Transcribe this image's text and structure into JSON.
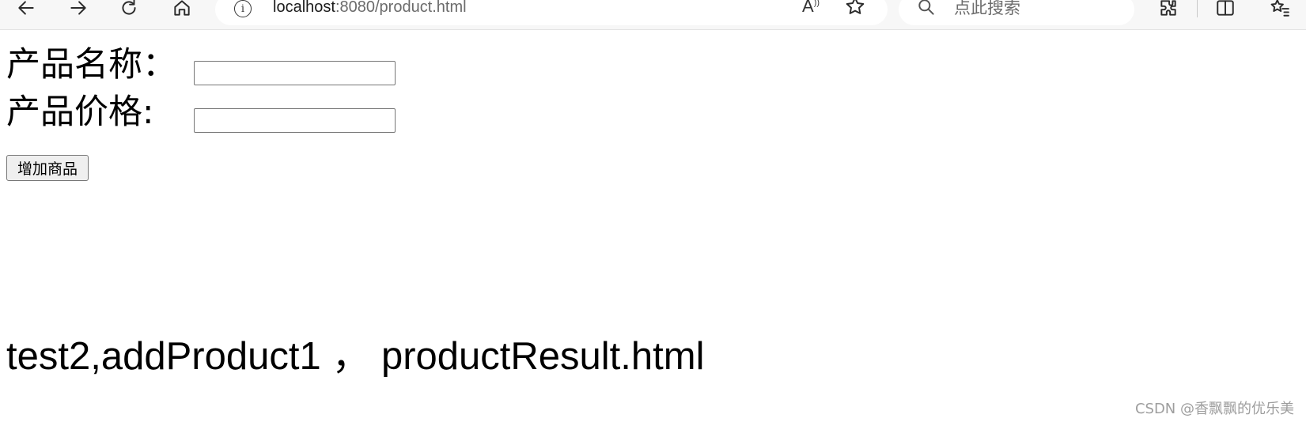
{
  "browser": {
    "address": {
      "host": "localhost",
      "rest": ":8080/product.html"
    },
    "read_aloud_label": "A",
    "search": {
      "placeholder": "点此搜索",
      "value": ""
    },
    "icons": [
      "back-arrow-icon",
      "forward-arrow-icon",
      "refresh-icon",
      "home-icon",
      "info-icon",
      "read-aloud-icon",
      "favorite-star-icon",
      "search-icon",
      "extensions-icon",
      "split-screen-icon",
      "favorites-icon"
    ]
  },
  "form": {
    "name_label": "产品名称：",
    "name_value": "",
    "price_label": "产品价格:",
    "price_value": "",
    "submit_label": "增加商品"
  },
  "result_text": "test2,addProduct1 ， productResult.html",
  "watermark": "CSDN @香飘飘的优乐美"
}
